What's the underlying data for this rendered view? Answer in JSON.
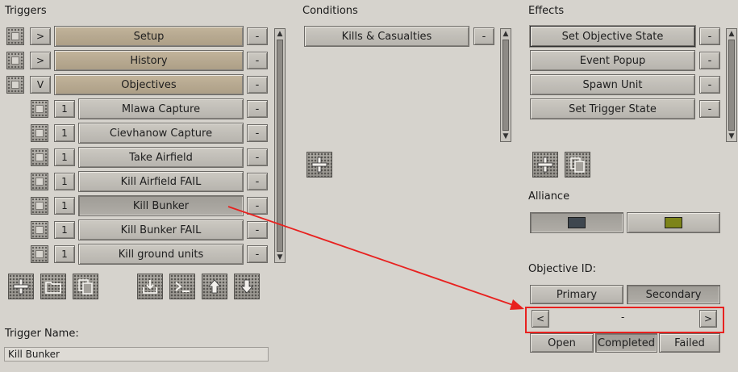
{
  "triggers": {
    "title": "Triggers",
    "groups": [
      {
        "toggle": ">",
        "label": "Setup"
      },
      {
        "toggle": ">",
        "label": "History"
      },
      {
        "toggle": "V",
        "label": "Objectives"
      }
    ],
    "items": [
      {
        "count": "1",
        "label": "Mlawa Capture"
      },
      {
        "count": "1",
        "label": "Cievhanow Capture"
      },
      {
        "count": "1",
        "label": "Take Airfield"
      },
      {
        "count": "1",
        "label": "Kill Airfield FAIL"
      },
      {
        "count": "1",
        "label": "Kill Bunker"
      },
      {
        "count": "1",
        "label": "Kill Bunker FAIL"
      },
      {
        "count": "1",
        "label": "Kill ground units"
      }
    ],
    "remove_label": "-",
    "selected_item": "Kill Bunker"
  },
  "conditions": {
    "title": "Conditions",
    "items": [
      {
        "label": "Kills & Casualties"
      }
    ],
    "remove_label": "-"
  },
  "effects": {
    "title": "Effects",
    "items": [
      {
        "label": "Set Objective State"
      },
      {
        "label": "Event Popup"
      },
      {
        "label": "Spawn Unit"
      },
      {
        "label": "Set Trigger State"
      }
    ],
    "remove_label": "-"
  },
  "alliance": {
    "title": "Alliance",
    "colors": [
      "#3f474f",
      "#7d8419"
    ]
  },
  "objective": {
    "title": "Objective ID:",
    "tabs": [
      "Primary",
      "Secondary"
    ],
    "prev": "<",
    "next": ">",
    "value": "-",
    "states": [
      "Open",
      "Completed",
      "Failed"
    ]
  },
  "trigger_name": {
    "label": "Trigger Name:",
    "value": "Kill Bunker"
  },
  "colors": {
    "annotation": "#e8211f",
    "tan_button": "#b9ab92"
  }
}
